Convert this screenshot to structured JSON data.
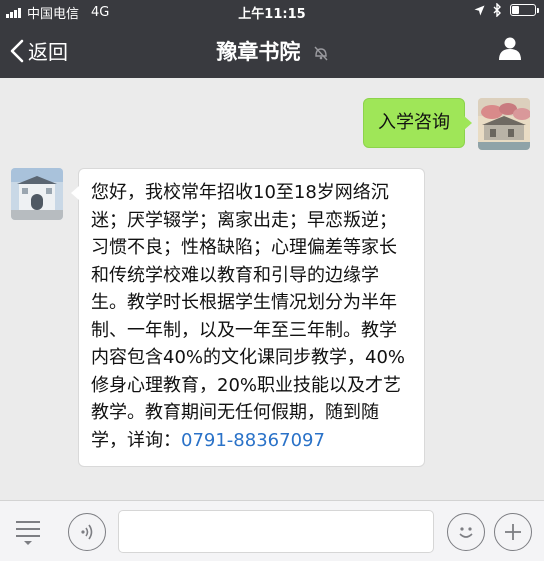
{
  "status_bar": {
    "carrier": "中国电信",
    "network": "4G",
    "time": "上午11:15"
  },
  "nav": {
    "back_label": "返回",
    "title": "豫章书院"
  },
  "messages": {
    "sent": {
      "text": "入学咨询"
    },
    "received": {
      "text": "您好，我校常年招收10至18岁网络沉迷；厌学辍学；离家出走；早恋叛逆；习惯不良；性格缺陷；心理偏差等家长和传统学校难以教育和引导的边缘学生。教学时长根据学生情况划分为半年制、一年制，以及一年至三年制。教学内容包含40%的文化课同步教学，40%修身心理教育，20%职业技能以及才艺教学。教育期间无任何假期，随到随学，详询：",
      "phone": "0791-88367097"
    }
  },
  "input_bar": {
    "menu_icon": "menu-lines-icon",
    "voice_icon": "voice-icon",
    "emoji_icon": "emoji-icon",
    "add_icon": "plus-icon"
  },
  "colors": {
    "header_bg": "#393a3f",
    "chat_bg": "#ebebeb",
    "sent_bubble": "#9fe658",
    "link": "#2a72c8"
  }
}
